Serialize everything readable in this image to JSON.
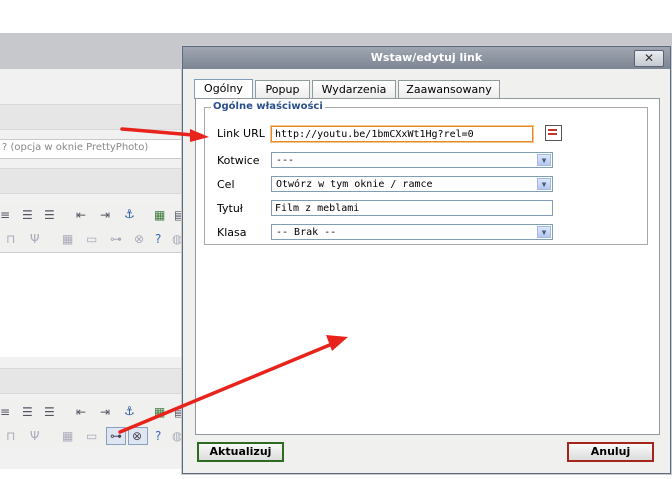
{
  "background": {
    "hint_text": "? (opcja w oknie PrettyPhoto)"
  },
  "dialog": {
    "title": "Wstaw/edytuj link",
    "close_glyph": "✕",
    "tabs": [
      {
        "label": "Ogólny",
        "active": true
      },
      {
        "label": "Popup",
        "active": false
      },
      {
        "label": "Wydarzenia",
        "active": false
      },
      {
        "label": "Zaawansowany",
        "active": false
      }
    ],
    "fieldset_legend": "Ogólne właściwości",
    "fields": {
      "link_url": {
        "label": "Link URL",
        "value": "http://youtu.be/1bmCXxWt1Hg?rel=0"
      },
      "anchors": {
        "label": "Kotwice",
        "value": "---"
      },
      "target": {
        "label": "Cel",
        "value": "Otwórz w tym oknie / ramce"
      },
      "title": {
        "label": "Tytuł",
        "value": "Film z meblami"
      },
      "class": {
        "label": "Klasa",
        "value": "-- Brak --"
      }
    },
    "buttons": {
      "update": "Aktualizuj",
      "cancel": "Anuluj"
    }
  },
  "colors": {
    "arrow": "#e8231c",
    "title_bar": "#8a919d",
    "legend": "#2b4f8c",
    "focus": "#e58a22"
  },
  "icons": [
    "close-icon",
    "browse-icon",
    "dropdown-arrow-icon",
    "toolbar-icons"
  ]
}
